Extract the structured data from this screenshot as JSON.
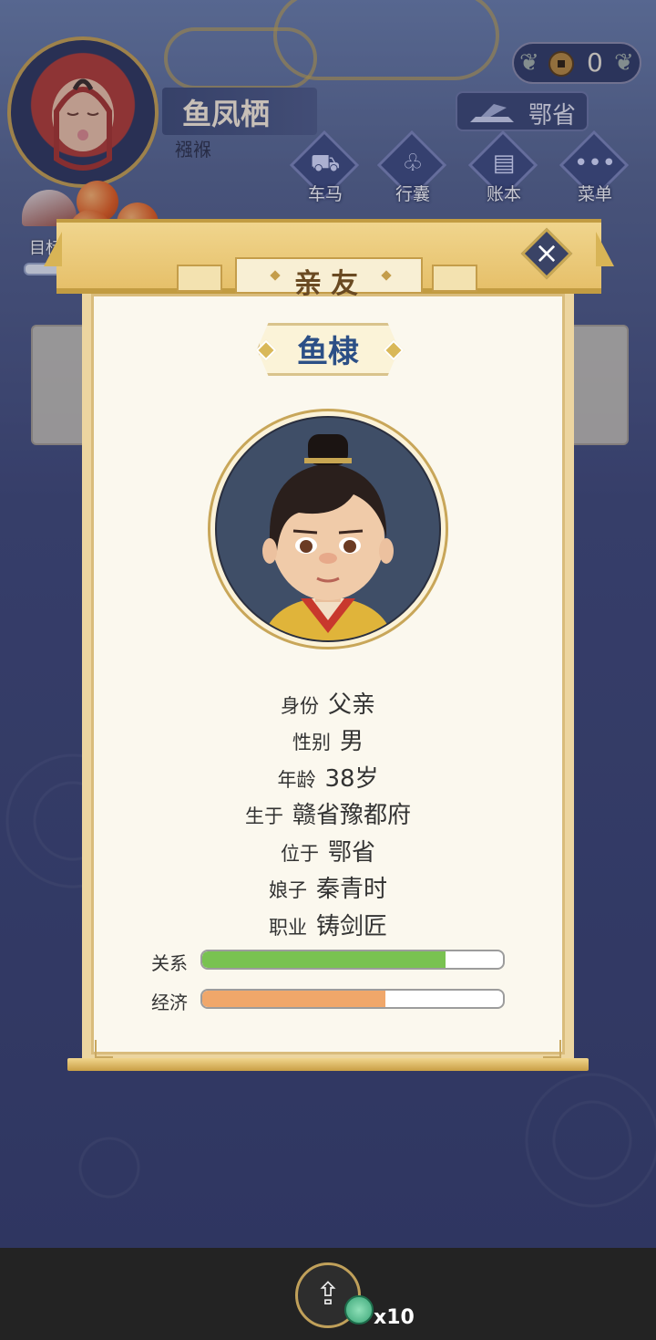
{
  "hud": {
    "player_name": "鱼凤栖",
    "player_status": "襁褓",
    "coins": "0",
    "location": "鄂省",
    "goal_label": "目标"
  },
  "menu": [
    {
      "label": "车马",
      "icon": "carriage-icon"
    },
    {
      "label": "行囊",
      "icon": "bundle-icon"
    },
    {
      "label": "账本",
      "icon": "ledger-icon"
    },
    {
      "label": "菜单",
      "icon": "more-icon"
    }
  ],
  "modal": {
    "title": "亲友",
    "person_name": "鱼棣",
    "rows": [
      {
        "key": "身份",
        "value": "父亲"
      },
      {
        "key": "性别",
        "value": "男"
      },
      {
        "key": "年龄",
        "value": "38岁"
      },
      {
        "key": "生于",
        "value": "赣省豫都府"
      },
      {
        "key": "位于",
        "value": "鄂省"
      },
      {
        "key": "娘子",
        "value": "秦青时"
      },
      {
        "key": "职业",
        "value": "铸剑匠"
      }
    ],
    "bars": [
      {
        "label": "关系",
        "value": 0.81,
        "color": "#79c251"
      },
      {
        "label": "经济",
        "value": 0.61,
        "color": "#f0a76a"
      }
    ]
  },
  "footer": {
    "share_count": "x10"
  }
}
